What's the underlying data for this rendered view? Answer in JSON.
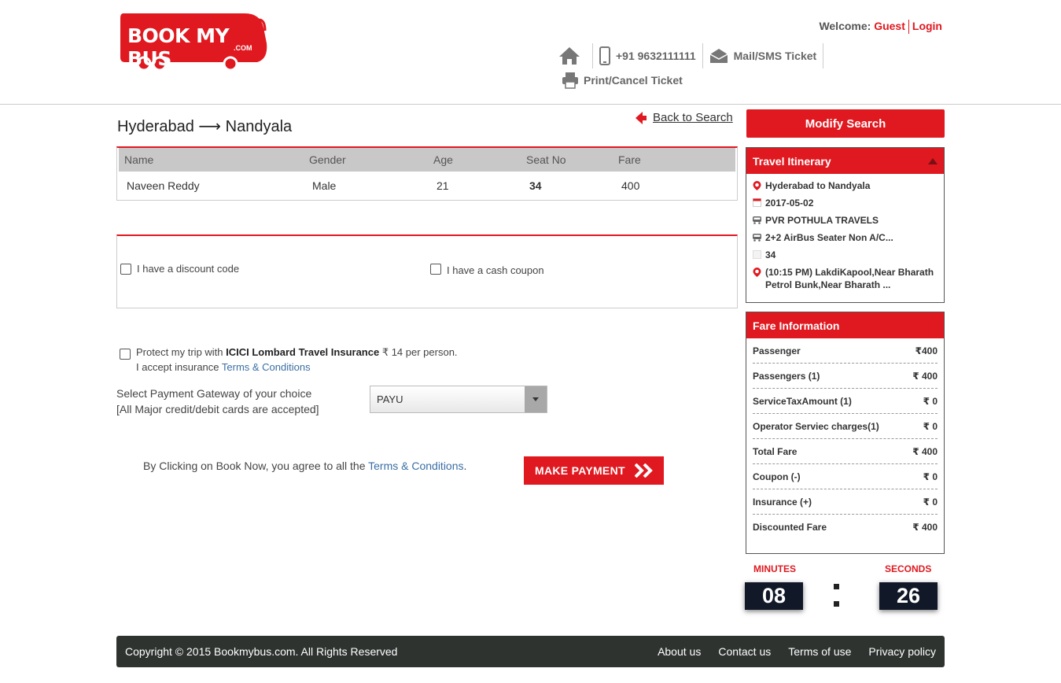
{
  "brand": {
    "logo_text": "BOOK MY BUS",
    "logo_sub": ".COM"
  },
  "header": {
    "welcome_label": "Welcome:",
    "guest": "Guest",
    "login": "Login",
    "phone": "+91 9632111111",
    "mail_sms": "Mail/SMS Ticket",
    "print_cancel": "Print/Cancel Ticket"
  },
  "route": {
    "from": "Hyderabad",
    "arrow": "⟶",
    "to": "Nandyala"
  },
  "back_to_search": "Back to Search",
  "passengers": {
    "columns": [
      "Name",
      "Gender",
      "Age",
      "Seat No",
      "Fare"
    ],
    "rows": [
      {
        "name": "Naveen Reddy",
        "gender": "Male",
        "age": "21",
        "seat": "34",
        "fare": "400"
      }
    ]
  },
  "discount": {
    "discount_code": "I have a discount code",
    "cash_coupon": "I have a cash coupon"
  },
  "insurance": {
    "pre": "Protect my trip with ",
    "brand": "ICICI Lombard Travel Insurance",
    "post": " ₹ 14 per person.",
    "accept": "I accept insurance ",
    "terms": "Terms & Conditions"
  },
  "gateway": {
    "label1": "Select Payment Gateway of your choice",
    "label2": "[All Major credit/debit cards are accepted]",
    "selected": "PAYU"
  },
  "agree": {
    "text": "By Clicking on Book Now, you agree to all the ",
    "link": "Terms & Conditions",
    "end": "."
  },
  "make_payment": "MAKE PAYMENT",
  "modify_search": "Modify Search",
  "itinerary": {
    "title": "Travel Itinerary",
    "route": "Hyderabad to Nandyala",
    "date": "2017-05-02",
    "operator": "PVR POTHULA TRAVELS",
    "bus_type": "2+2 AirBus Seater Non A/C...",
    "seat": "34",
    "boarding": "(10:15 PM) LakdiKapool,Near Bharath Petrol Bunk,Near Bharath ..."
  },
  "fare_info": {
    "title": "Fare Information",
    "rows": [
      {
        "label": "Passenger",
        "value": "₹400"
      },
      {
        "label": "Passengers (1)",
        "value": "₹ 400"
      },
      {
        "label": "ServiceTaxAmount (1)",
        "value": "₹ 0"
      },
      {
        "label": "Operator Serviec charges(1)",
        "value": "₹ 0"
      },
      {
        "label": "Total Fare",
        "value": "₹ 400"
      },
      {
        "label": "Coupon (-)",
        "value": "₹ 0"
      },
      {
        "label": "Insurance (+)",
        "value": "₹ 0"
      },
      {
        "label": "Discounted Fare",
        "value": "₹ 400"
      }
    ]
  },
  "timer": {
    "minutes_label": "MINUTES",
    "seconds_label": "SECONDS",
    "minutes": "08",
    "seconds": "26"
  },
  "footer": {
    "copyright": "Copyright © 2015 Bookmybus.com. All Rights Reserved",
    "links": [
      "About us",
      "Contact us",
      "Terms of use",
      "Privacy policy"
    ]
  },
  "colors": {
    "accent": "#e0181f",
    "footer_bg": "#2e3330",
    "link": "#3a6ea5"
  }
}
